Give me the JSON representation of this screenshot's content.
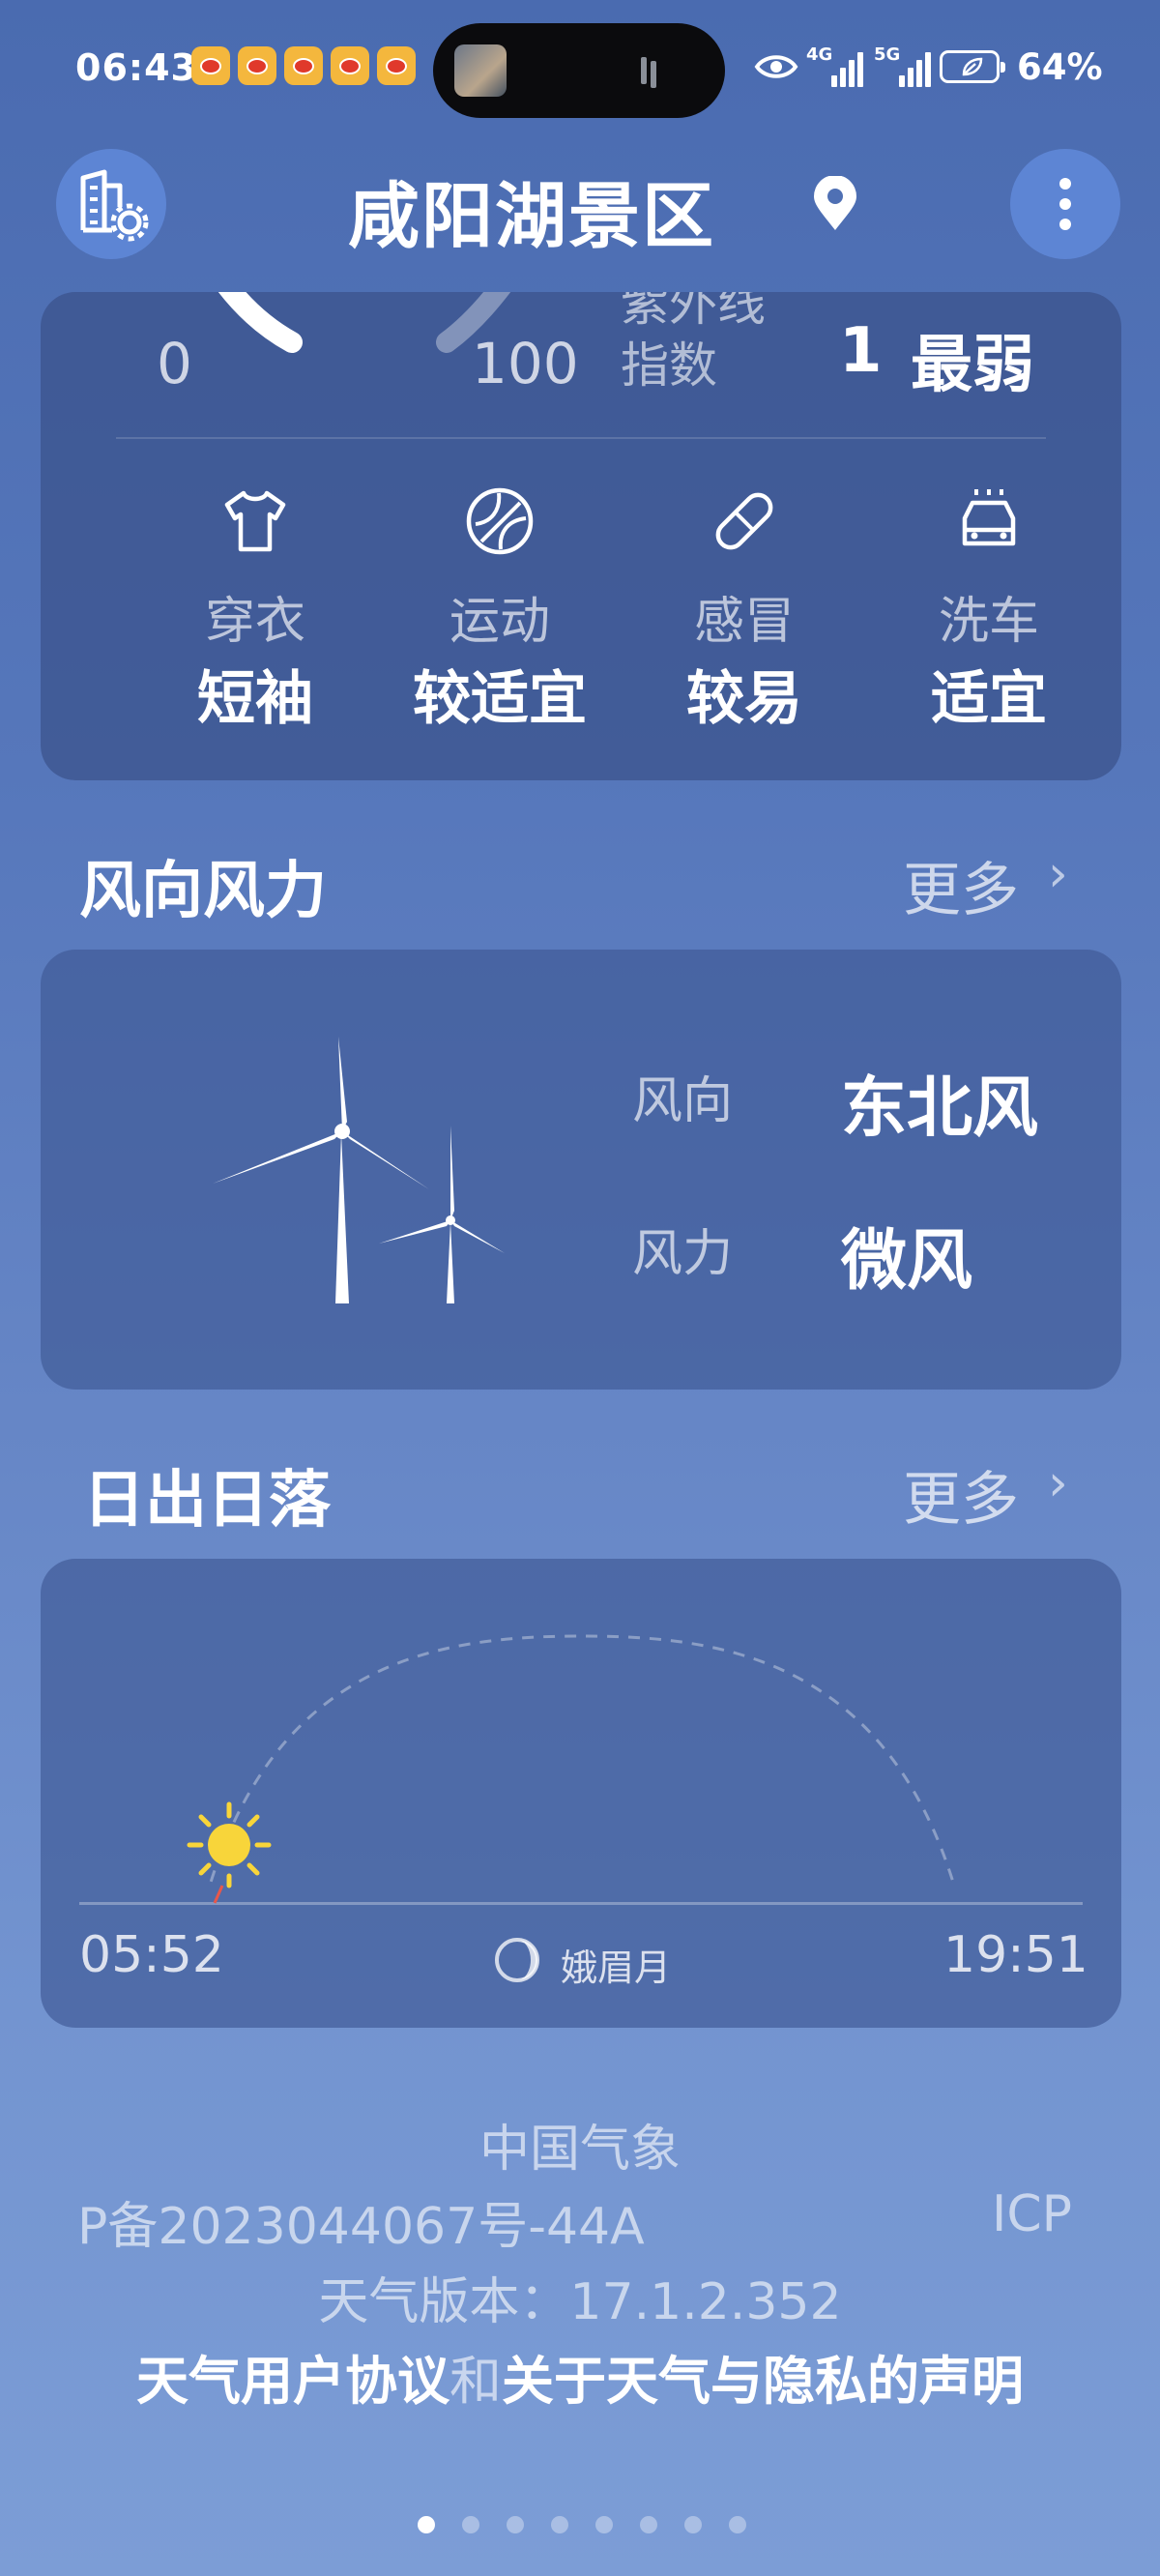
{
  "status_bar": {
    "time": "06:43",
    "signal_4g": "4G",
    "signal_5g": "5G",
    "battery": "64%",
    "icons": [
      "weibo-icon",
      "weibo-icon",
      "weibo-icon",
      "weibo-icon",
      "weibo-icon",
      "eye-icon",
      "signal-icon",
      "signal-icon",
      "battery-icon"
    ]
  },
  "header": {
    "title": "咸阳湖景区",
    "icons": [
      "city-settings-icon",
      "location-pin-icon",
      "more-menu-icon"
    ]
  },
  "uv": {
    "min": "0",
    "max": "100",
    "label_top": "紫外线",
    "label_bottom": "指数",
    "level_value": "1",
    "level_text": "最弱"
  },
  "life_index": [
    {
      "icon": "tshirt-icon",
      "label": "穿衣",
      "value": "短袖"
    },
    {
      "icon": "ball-icon",
      "label": "运动",
      "value": "较适宜"
    },
    {
      "icon": "pill-icon",
      "label": "感冒",
      "value": "较易"
    },
    {
      "icon": "car-wash-icon",
      "label": "洗车",
      "value": "适宜"
    }
  ],
  "wind": {
    "section_title": "风向风力",
    "more_label": "更多",
    "direction_label": "风向",
    "direction_value": "东北风",
    "force_label": "风力",
    "force_value": "微风"
  },
  "sun": {
    "section_title": "日出日落",
    "more_label": "更多",
    "sunrise": "05:52",
    "sunset": "19:51",
    "moon_phase": "娥眉月"
  },
  "footer": {
    "source": "中国气象",
    "icp": "P备2023044067号-44A",
    "icp_right": "ICP",
    "version": "天气版本：17.1.2.352",
    "agreement_link": "天气用户协议",
    "and_text": "和",
    "privacy_link": "关于天气与隐私的声明"
  },
  "pager": {
    "count": 8,
    "active": 1
  },
  "colors": {
    "sun": "#f8d53a",
    "card": "#3a528a",
    "background_top": "#4a6bb0",
    "background_bottom": "#7c9dd6"
  }
}
